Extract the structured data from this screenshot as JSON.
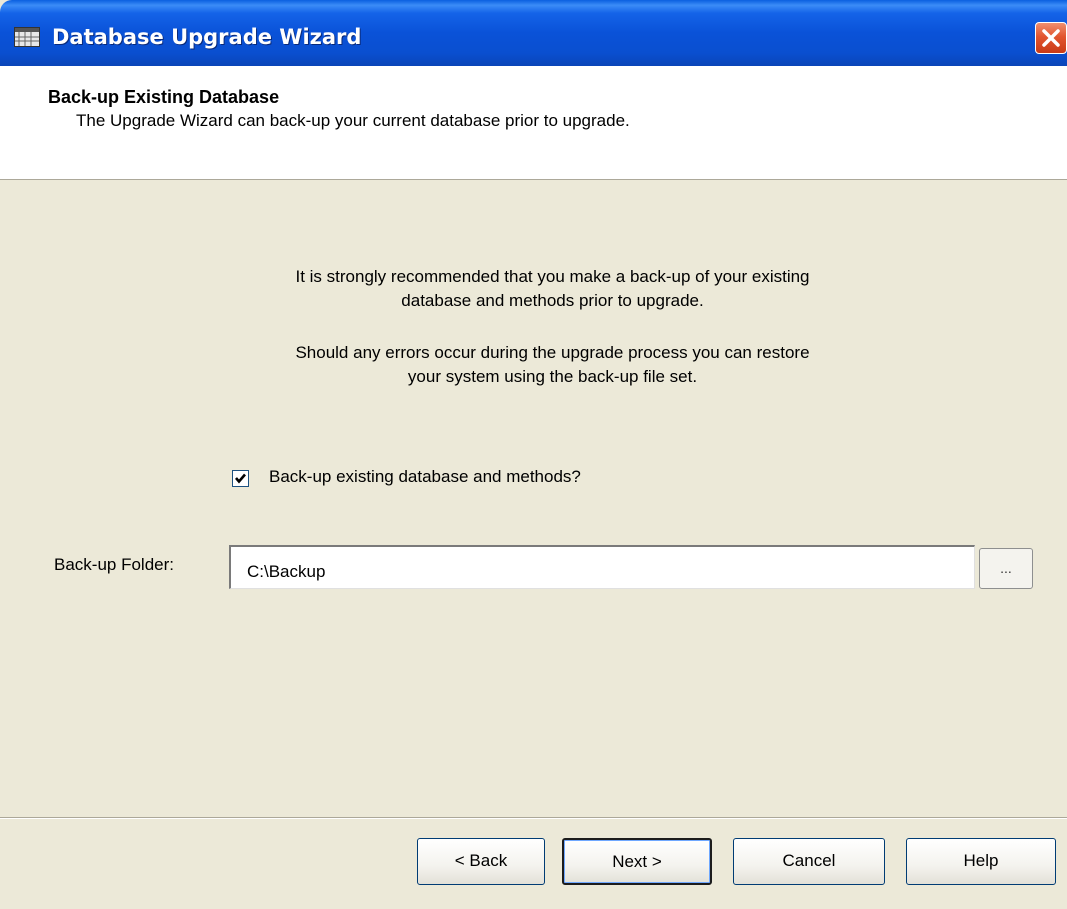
{
  "window": {
    "title": "Database Upgrade Wizard",
    "icon": "database-icon",
    "close_icon": "close-icon"
  },
  "header": {
    "title": "Back-up Existing Database",
    "subtitle": "The Upgrade Wizard can back-up your current database prior to upgrade."
  },
  "body": {
    "paragraph1_line1": "It is strongly recommended that you make a back-up of your existing",
    "paragraph1_line2": "database and methods prior to upgrade.",
    "paragraph2_line1": "Should any errors occur during the upgrade process you can restore",
    "paragraph2_line2": "your system using the back-up file set.",
    "backup_checkbox": {
      "label": "Back-up existing database and methods?",
      "checked": true
    },
    "folder": {
      "label": "Back-up Folder:",
      "value": "C:\\Backup",
      "browse_label": "..."
    }
  },
  "footer": {
    "back_label": "< Back",
    "next_label": "Next >",
    "cancel_label": "Cancel",
    "help_label": "Help"
  },
  "colors": {
    "titlebar": "#0a52d8",
    "dialog_bg": "#ece9d8",
    "close_button": "#e2552f"
  }
}
